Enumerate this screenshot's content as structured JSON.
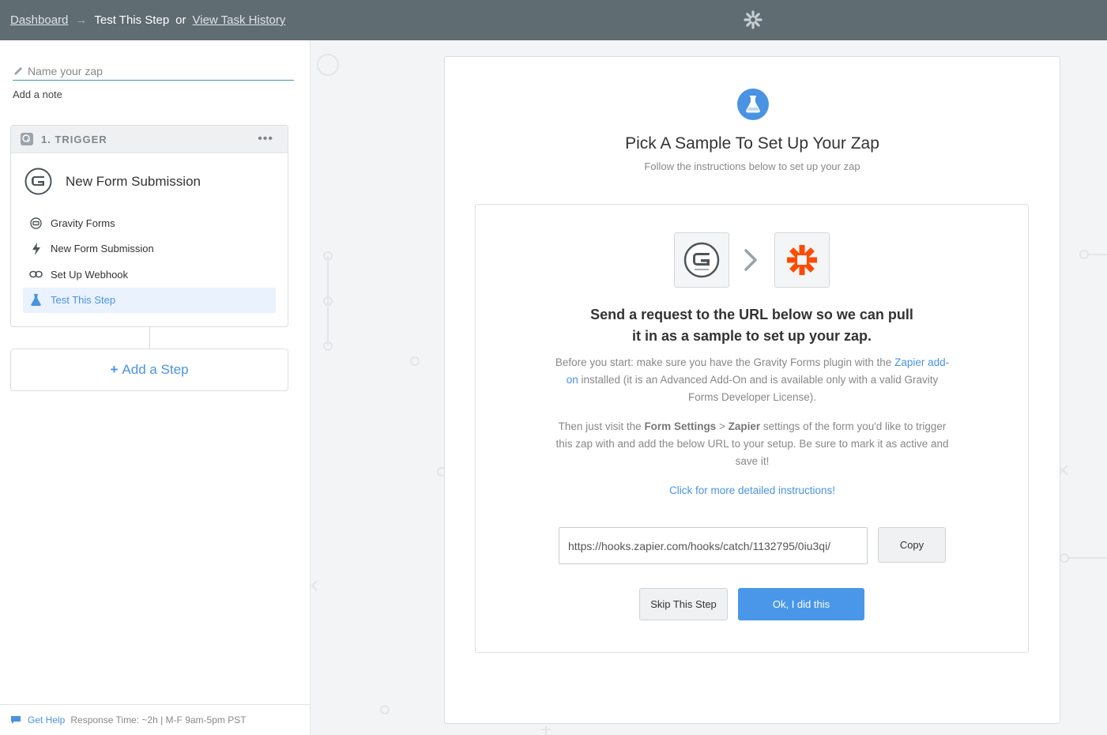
{
  "topbar": {
    "dashboard_label": "Dashboard",
    "arrow": "→",
    "current_label": "Test This Step",
    "or_label": "or",
    "history_label": "View Task History",
    "logo_icon": "zapier-asterisk-icon"
  },
  "sidebar": {
    "zap_name_placeholder": "Name your zap",
    "add_note_label": "Add a note",
    "trigger": {
      "label": "1. TRIGGER",
      "menu_icon": "more-dots-icon",
      "title": "New Form Submission",
      "steps": [
        {
          "label": "Gravity Forms",
          "icon": "gravity-forms-icon"
        },
        {
          "label": "New Form Submission",
          "icon": "lightning-icon"
        },
        {
          "label": "Set Up Webhook",
          "icon": "chain-link-icon"
        },
        {
          "label": "Test This Step",
          "icon": "flask-icon",
          "active": true
        }
      ]
    },
    "add_step_label": "Add a Step",
    "add_step_plus": "+",
    "help": {
      "link_label": "Get Help",
      "meta": "Response Time: ~2h | M-F 9am-5pm PST"
    }
  },
  "main": {
    "title": "Pick A Sample To Set Up Your Zap",
    "subtitle": "Follow the instructions below to set up your zap",
    "headline_line1": "Send a request to the URL below so we can pull",
    "headline_line2": "it in as a sample to set up your zap.",
    "para1_before": "Before you start: make sure you have the Gravity Forms plugin with the",
    "para1_link": "Zapier add-on",
    "para1_after": "installed (it is an Advanced Add-On and is available only with a valid Gravity Forms Developer License).",
    "para2_before": "Then just visit the",
    "para2_bold1": "Form Settings",
    "para2_sep": ">",
    "para2_bold2": "Zapier",
    "para2_after": "settings of the form you'd like to trigger this zap with and add the below URL to your setup. Be sure to mark it as active and save it!",
    "instructions_link": "Click for more detailed instructions!",
    "webhook_url": "https://hooks.zapier.com/hooks/catch/1132795/0iu3qi/",
    "copy_label": "Copy",
    "skip_label": "Skip This Step",
    "ok_label": "Ok, I did this"
  },
  "colors": {
    "accent": "#4a93e2",
    "topbar": "#5f6c72",
    "zapier_orange": "#ff4a00"
  }
}
